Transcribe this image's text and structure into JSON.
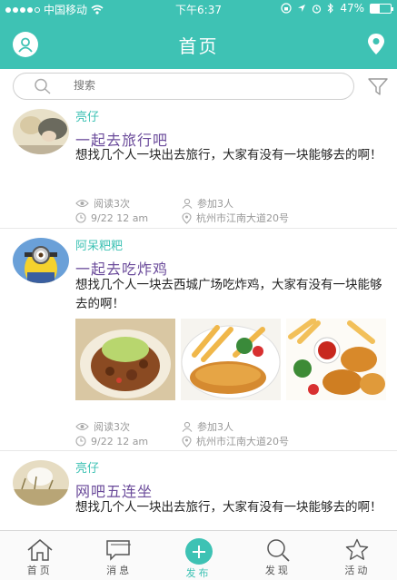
{
  "status_bar": {
    "carrier": "中国移动",
    "time": "下午6:37",
    "battery": "47%",
    "battery_level": 0.47
  },
  "header": {
    "title": "首页"
  },
  "search": {
    "placeholder": "搜索"
  },
  "posts": [
    {
      "author": "亮仔",
      "title": "一起去旅行吧",
      "body": "想找几个人一块出去旅行，大家有没有一块能够去的啊！",
      "views": "阅读3次",
      "joined": "参加3人",
      "date": "9/22 12 am",
      "location": "杭州市江南大道20号"
    },
    {
      "author": "阿呆粑粑",
      "title": "一起去吃炸鸡",
      "body": "想找几个人一块去西城广场吃炸鸡，大家有没有一块能够去的啊！",
      "views": "阅读3次",
      "joined": "参加3人",
      "date": "9/22 12 am",
      "location": "杭州市江南大道20号"
    },
    {
      "author": "亮仔",
      "title": "网吧五连坐",
      "body": "想找几个人一块出去旅行，大家有没有一块能够去的啊！"
    }
  ],
  "tabs": [
    {
      "label": "首页",
      "icon": "home-icon"
    },
    {
      "label": "消息",
      "icon": "message-icon"
    },
    {
      "label": "发布",
      "icon": "plus-icon"
    },
    {
      "label": "发现",
      "icon": "search-icon"
    },
    {
      "label": "活动",
      "icon": "star-icon"
    }
  ],
  "colors": {
    "accent": "#3ec2b4",
    "title": "#6a4a9a"
  }
}
